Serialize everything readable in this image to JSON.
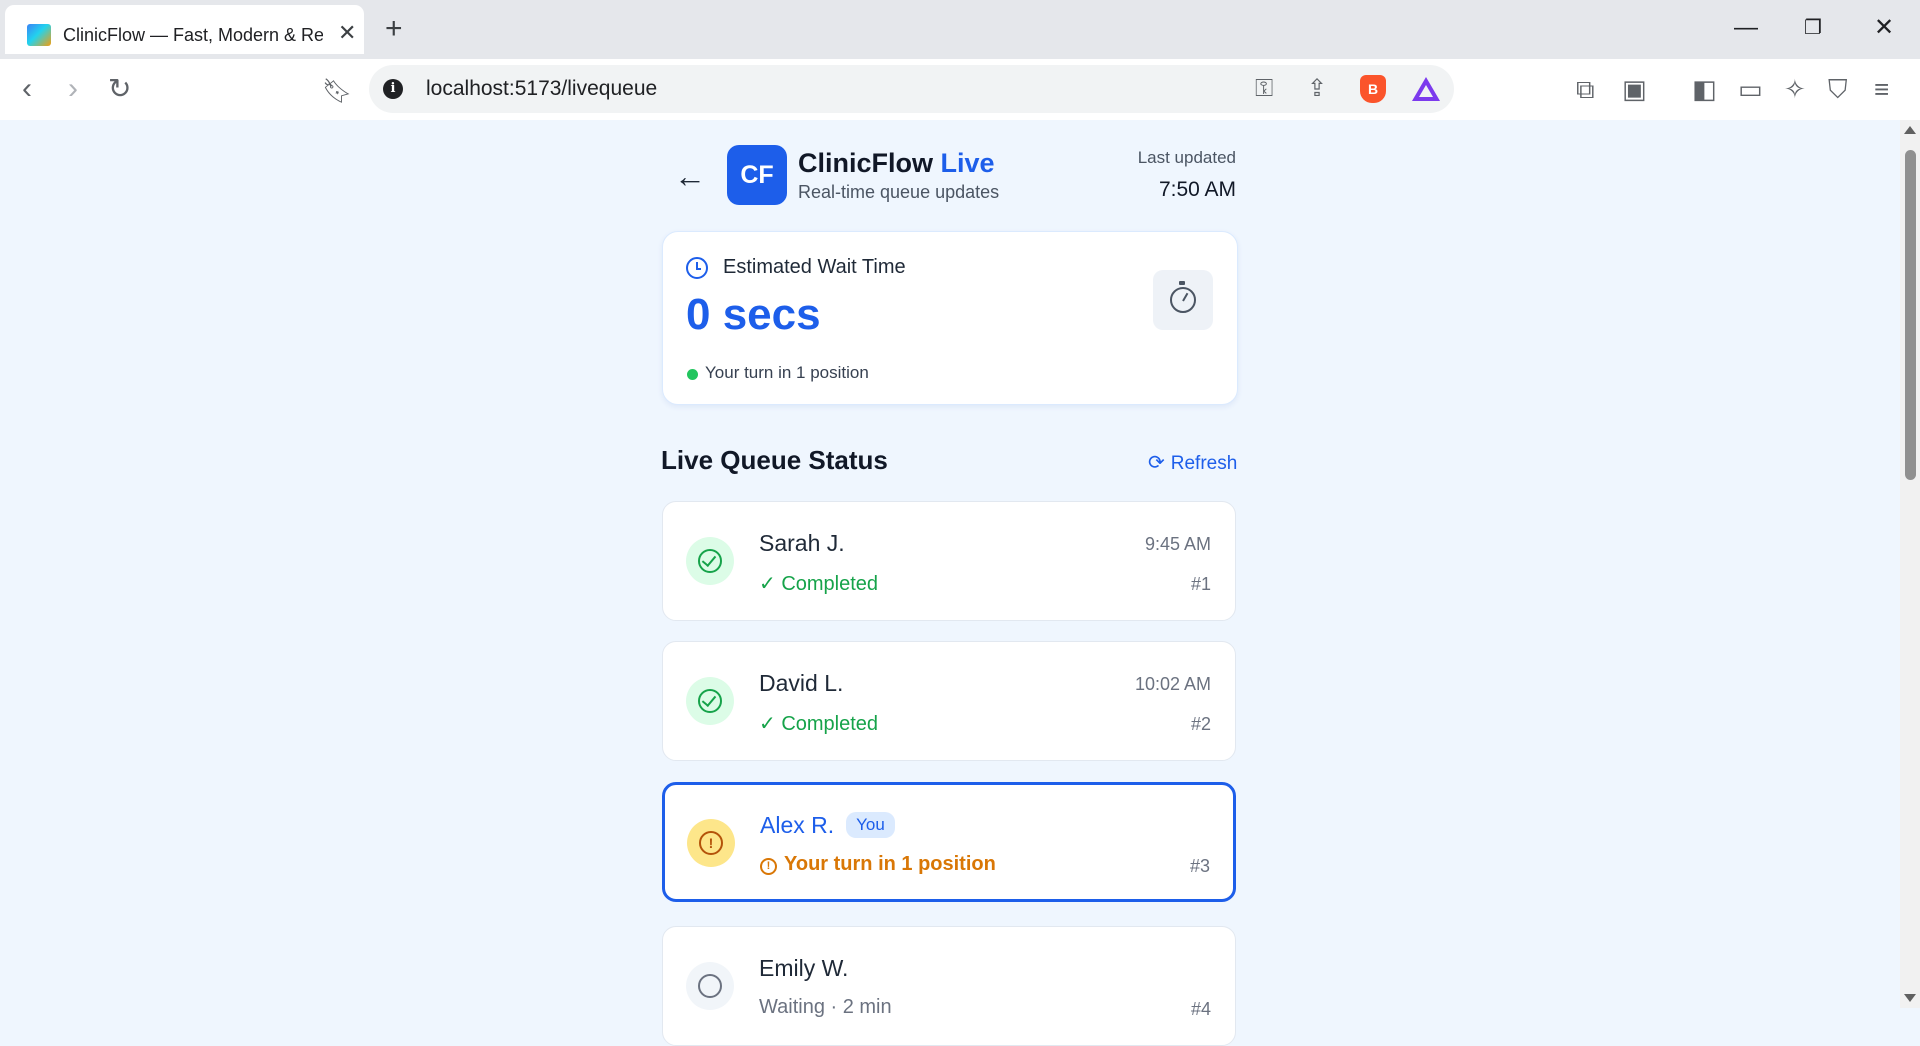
{
  "browser": {
    "tab_title": "ClinicFlow — Fast, Modern & Res",
    "url": "localhost:5173/livequeue"
  },
  "header": {
    "logo_text": "CF",
    "title_main": "ClinicFlow",
    "title_accent": "Live",
    "subtitle": "Real-time queue updates",
    "last_updated_label": "Last updated",
    "last_updated_time": "7:50 AM"
  },
  "wait_card": {
    "label": "Estimated Wait Time",
    "value": "0 secs",
    "note": "Your turn in 1 position"
  },
  "queue": {
    "title": "Live Queue Status",
    "refresh_label": "Refresh",
    "items": [
      {
        "name": "Sarah J.",
        "status": "✓ Completed",
        "time": "9:45 AM",
        "number": "#1",
        "state": "done"
      },
      {
        "name": "David L.",
        "status": "✓ Completed",
        "time": "10:02 AM",
        "number": "#2",
        "state": "done"
      },
      {
        "name": "Alex R.",
        "badge": "You",
        "status": "Your turn in 1 position",
        "time": "",
        "number": "#3",
        "state": "current"
      },
      {
        "name": "Emily W.",
        "status": "Waiting · 2 min",
        "time": "",
        "number": "#4",
        "state": "waiting"
      }
    ]
  },
  "colors": {
    "accent": "#1d5eea",
    "success": "#16a34a",
    "warning": "#d97706",
    "background": "#eff6fe"
  }
}
